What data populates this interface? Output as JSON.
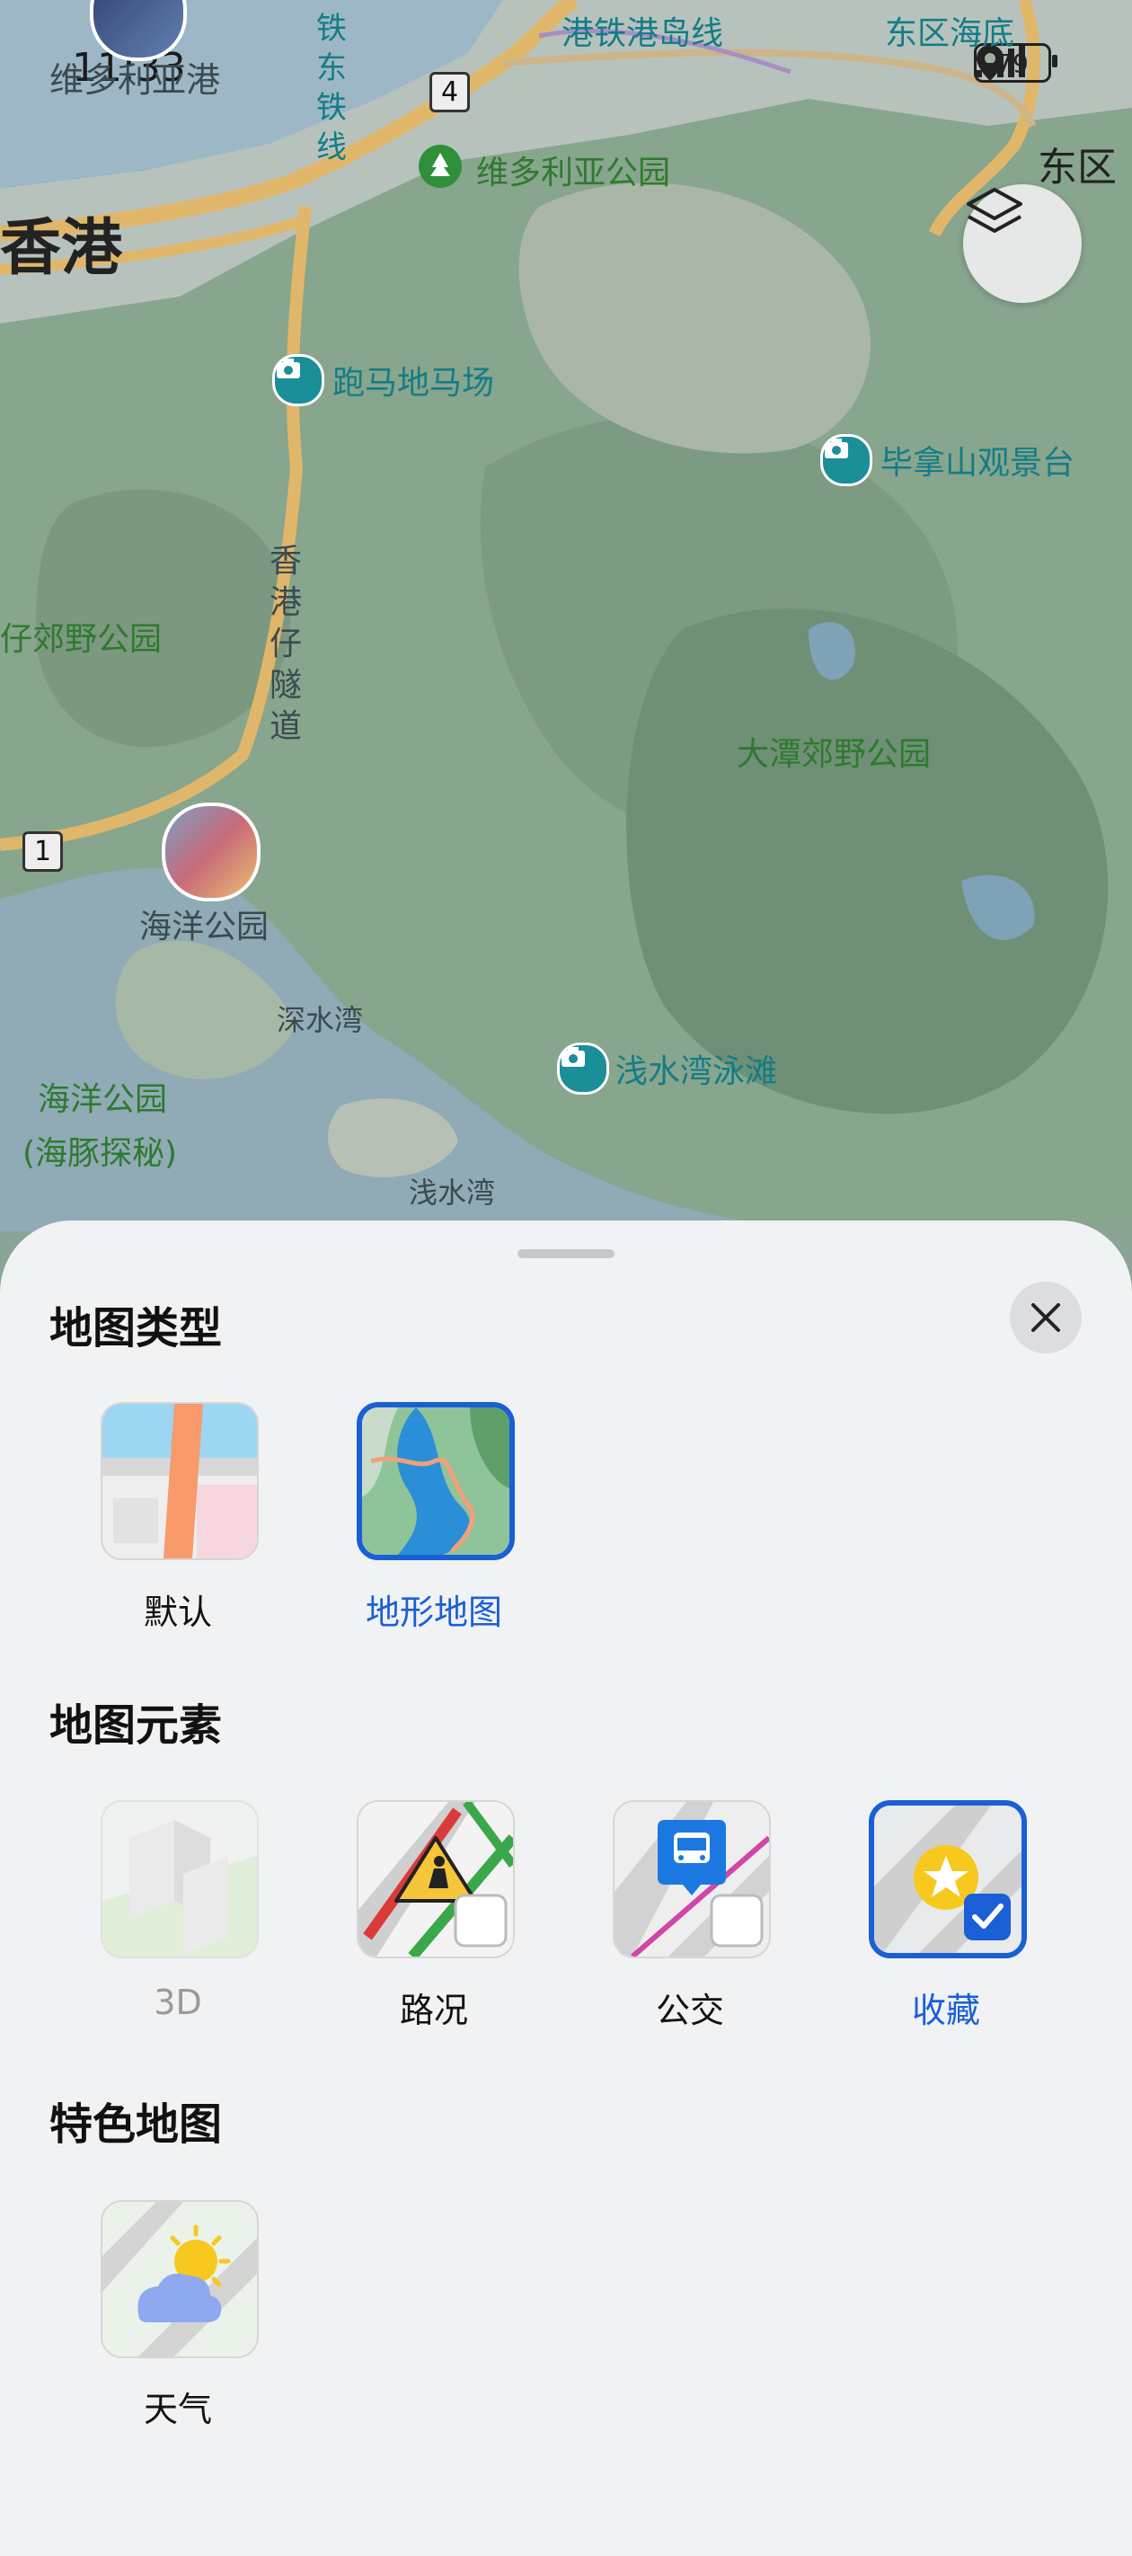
{
  "status_bar": {
    "time": "11:33",
    "battery": "79"
  },
  "map": {
    "labels": {
      "hk": "香港",
      "victoria_harbour": "维多利亚港",
      "victoria_park": "维多利亚公园",
      "mtr_island_line": "港铁港岛线",
      "east_district": "东区",
      "mtr_east_line": "东区海底",
      "line_fragment": "线",
      "tram_line": "铁东铁线",
      "happy_valley": "跑马地马场",
      "braemar": "毕拿山观景台",
      "country_park_left": "仔郊野公园",
      "tunnel": "香港仔隧道",
      "tai_tam": "大潭郊野公园",
      "ocean_park": "海洋公园",
      "deep_water_bay": "深水湾",
      "repulse_bay_beach": "浅水湾泳滩",
      "ocean_park_dolphin": "海洋公园",
      "ocean_park_dolphin_sub": "(海豚探秘)",
      "repulse_bay": "浅水湾",
      "route_4": "4",
      "route_1": "1"
    }
  },
  "sheet": {
    "sections": {
      "map_type": "地图类型",
      "map_elements": "地图元素",
      "special_maps": "特色地图"
    },
    "map_types": [
      {
        "label": "默认",
        "selected": false
      },
      {
        "label": "地形地图",
        "selected": true
      }
    ],
    "map_elements": [
      {
        "label": "3D",
        "selected": false,
        "disabled": true
      },
      {
        "label": "路况",
        "selected": false
      },
      {
        "label": "公交",
        "selected": false
      },
      {
        "label": "收藏",
        "selected": true
      }
    ],
    "special_maps": [
      {
        "label": "天气",
        "selected": false
      }
    ]
  },
  "colors": {
    "accent": "#1a5fd6",
    "sheet_bg": "#f1f2f4",
    "map_green": "#8aa88d"
  }
}
